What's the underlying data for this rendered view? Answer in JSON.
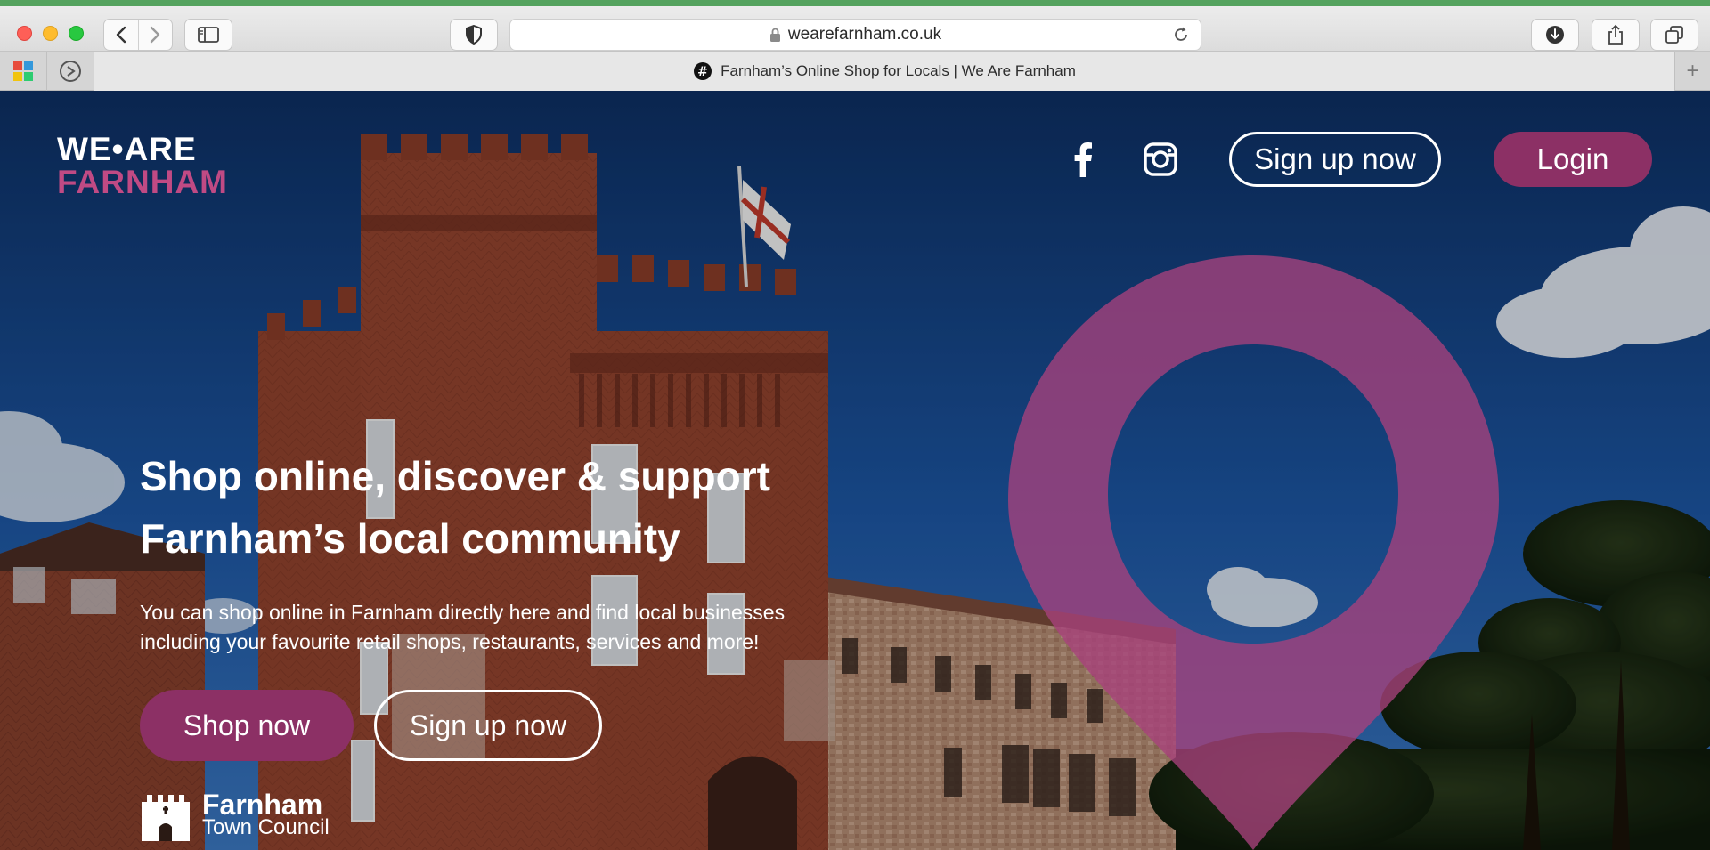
{
  "browser": {
    "url": "wearefarnham.co.uk",
    "tab_title": "Farnham’s Online Shop for Locals | We Are Farnham",
    "new_tab_label": "+"
  },
  "header": {
    "logo_line1": "WE•ARE",
    "logo_line2": "FARNHAM",
    "signup_label": "Sign up now",
    "login_label": "Login"
  },
  "hero": {
    "headline_line1": "Shop online, discover & support",
    "headline_line2": "Farnham’s local community",
    "subtext_line1": "You can shop online in Farnham directly here and find local businesses",
    "subtext_line2": "including your favourite retail shops, restaurants, services and more!",
    "shop_label": "Shop now",
    "signup_label": "Sign up now"
  },
  "footer_logo": {
    "name": "Farnham",
    "sub": "Town Council"
  },
  "colors": {
    "brand_purple": "#8c3065",
    "brand_pink": "#c04a84"
  },
  "icons": [
    "back-arrow-icon",
    "forward-arrow-icon",
    "sidebar-icon",
    "shield-icon",
    "lock-icon",
    "reload-icon",
    "download-icon",
    "share-icon",
    "tabs-icon",
    "facebook-icon",
    "instagram-icon",
    "location-pin-icon",
    "castle-icon"
  ]
}
